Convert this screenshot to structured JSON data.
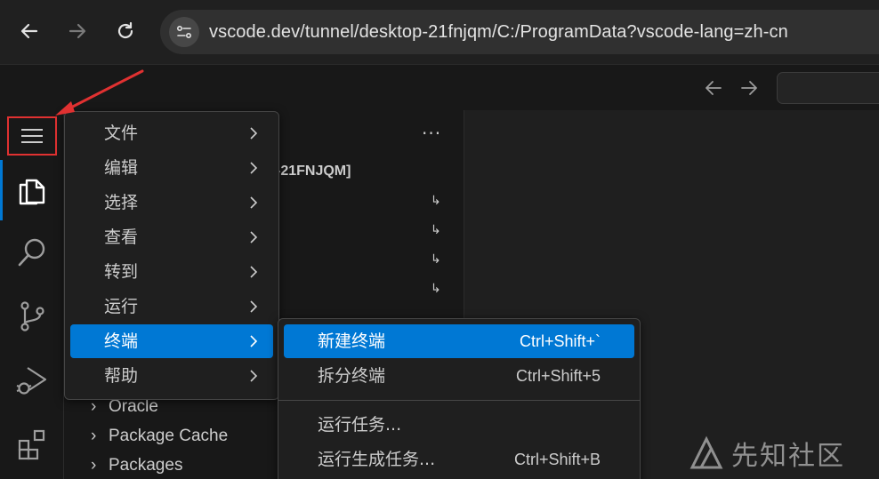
{
  "browser": {
    "url": "vscode.dev/tunnel/desktop-21fnjqm/C:/ProgramData?vscode-lang=zh-cn"
  },
  "sidebar": {
    "more_label": "···",
    "folder_title": "-21FNJQM]",
    "glyph": "↳",
    "tree_items": [
      {
        "label": "Oracle"
      },
      {
        "label": "Package Cache"
      },
      {
        "label": "Packages"
      }
    ]
  },
  "main_menu": {
    "items": [
      {
        "label": "文件"
      },
      {
        "label": "编辑"
      },
      {
        "label": "选择"
      },
      {
        "label": "查看"
      },
      {
        "label": "转到"
      },
      {
        "label": "运行"
      },
      {
        "label": "终端"
      },
      {
        "label": "帮助"
      }
    ],
    "active_index": 6
  },
  "terminal_menu": {
    "items": [
      {
        "label": "新建终端",
        "shortcut": "Ctrl+Shift+`"
      },
      {
        "label": "拆分终端",
        "shortcut": "Ctrl+Shift+5"
      },
      {
        "label": "运行任务...",
        "shortcut": ""
      },
      {
        "label": "运行生成任务...",
        "shortcut": "Ctrl+Shift+B"
      }
    ]
  },
  "watermark": {
    "text": "先知社区"
  },
  "colors": {
    "accent": "#0078d4",
    "annotation": "#e03131",
    "background": "#1f1f1f"
  },
  "icons": [
    "back-arrow-icon",
    "forward-arrow-icon",
    "reload-icon",
    "site-info-icon",
    "hamburger-menu-icon",
    "explorer-icon",
    "search-icon",
    "source-control-icon",
    "run-debug-icon",
    "extensions-icon",
    "chevron-right-icon"
  ]
}
